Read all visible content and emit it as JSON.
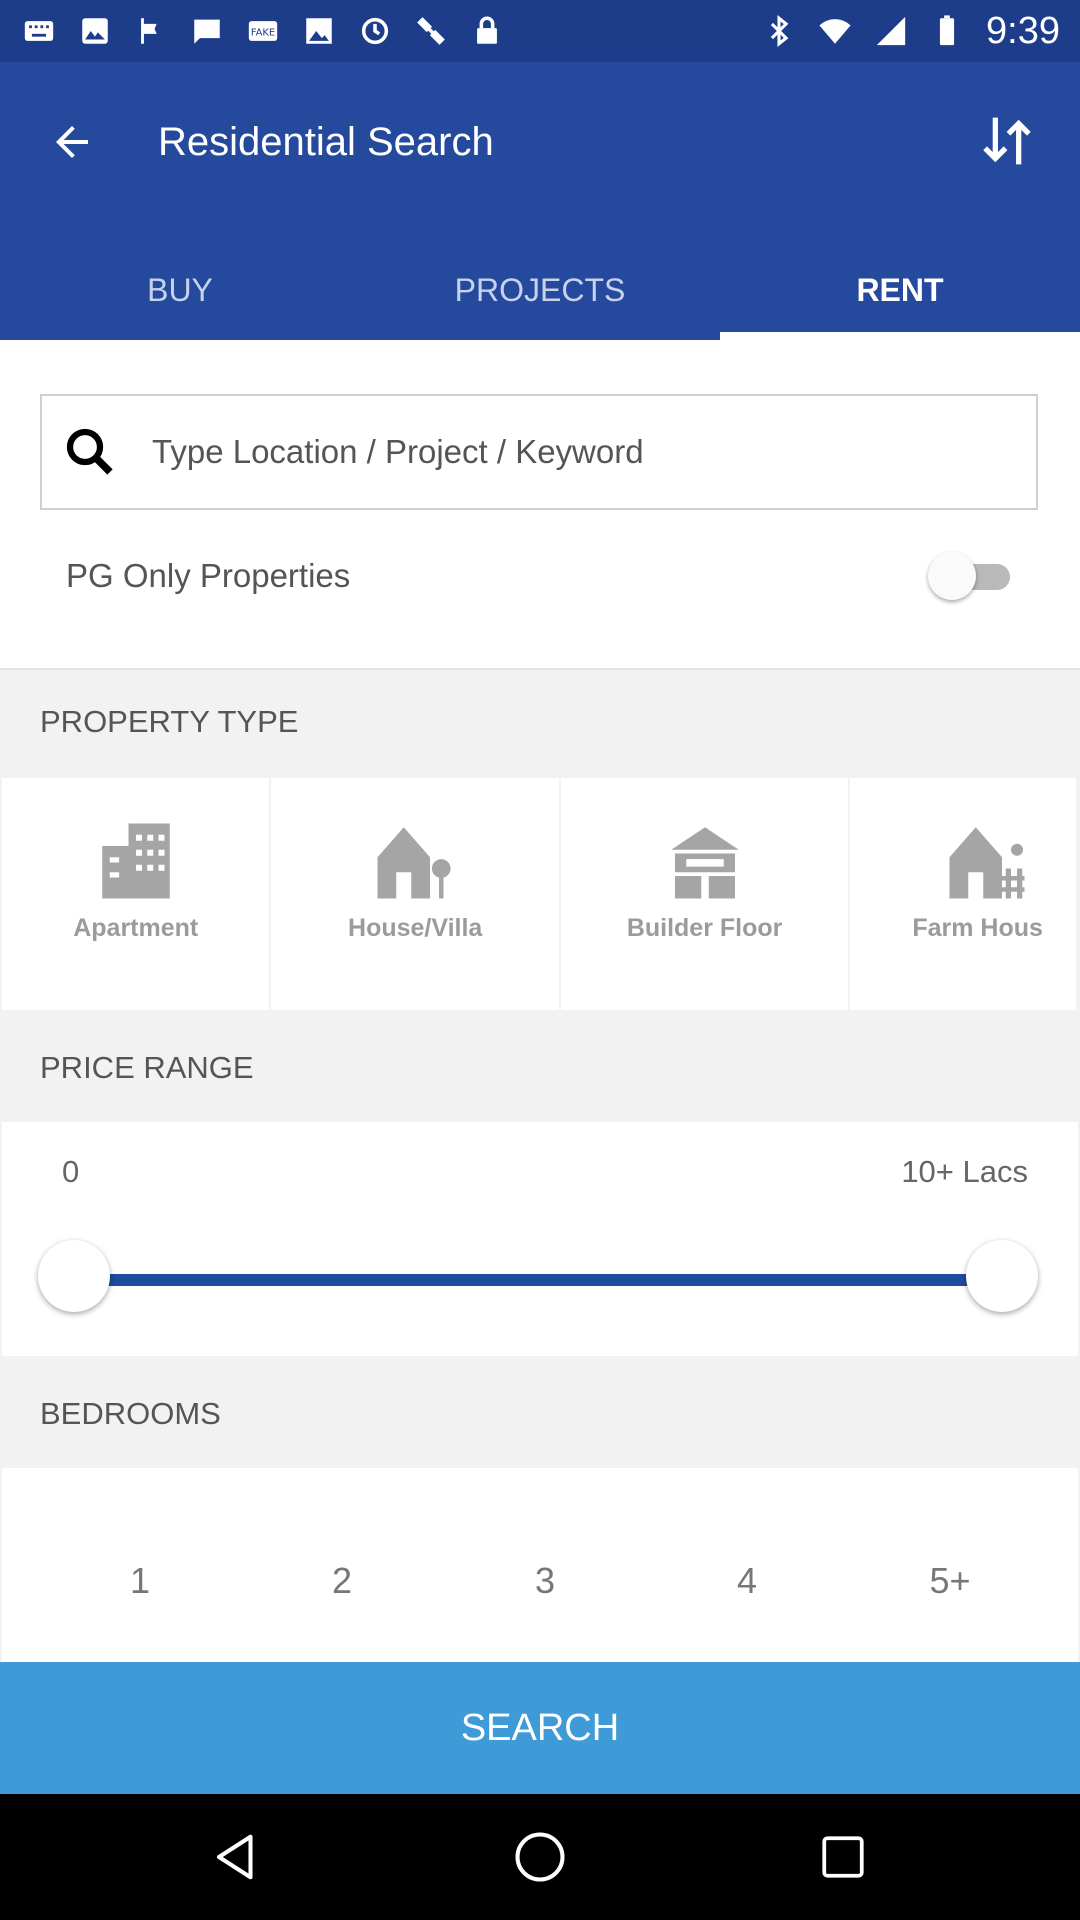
{
  "status_bar": {
    "time": "9:39",
    "left_icons": [
      "keyboard-icon",
      "gallery-icon",
      "flag-icon",
      "message-icon",
      "vpn-key-icon",
      "image-icon",
      "sync-icon",
      "satellite-icon",
      "lock-icon"
    ],
    "right_icons": [
      "bluetooth-icon",
      "wifi-icon",
      "signal-icon",
      "battery-icon"
    ]
  },
  "app_bar": {
    "title": "Residential Search",
    "back_icon": "arrow-back-icon",
    "sort_icon": "sort-arrows-icon"
  },
  "tabs": [
    {
      "label": "BUY",
      "active": false
    },
    {
      "label": "PROJECTS",
      "active": false
    },
    {
      "label": "RENT",
      "active": true
    }
  ],
  "search": {
    "placeholder": "Type Location / Project / Keyword",
    "value": "",
    "icon": "search-icon"
  },
  "pg_only": {
    "label": "PG Only Properties",
    "enabled": false
  },
  "property_type": {
    "title": "PROPERTY TYPE",
    "items": [
      {
        "label": "Apartment",
        "icon": "apartment-icon"
      },
      {
        "label": "House/Villa",
        "icon": "house-villa-icon"
      },
      {
        "label": "Builder Floor",
        "icon": "builder-floor-icon"
      },
      {
        "label": "Farm Hous",
        "icon": "farm-house-icon"
      }
    ]
  },
  "price_range": {
    "title": "PRICE RANGE",
    "min_label": "0",
    "max_label": "10+ Lacs",
    "selected_min_fraction": 0,
    "selected_max_fraction": 1
  },
  "bedrooms": {
    "title": "BEDROOMS",
    "options": [
      "1",
      "2",
      "3",
      "4",
      "5+"
    ]
  },
  "search_button": {
    "label": "SEARCH"
  },
  "colors": {
    "status_bar": "#1d3c8a",
    "app_bar": "#254a9d",
    "search_button": "#3e9bd8",
    "slider": "#1f4a9d"
  },
  "nav_bar": {
    "icons": [
      "back-triangle-icon",
      "home-circle-icon",
      "recents-square-icon"
    ]
  }
}
